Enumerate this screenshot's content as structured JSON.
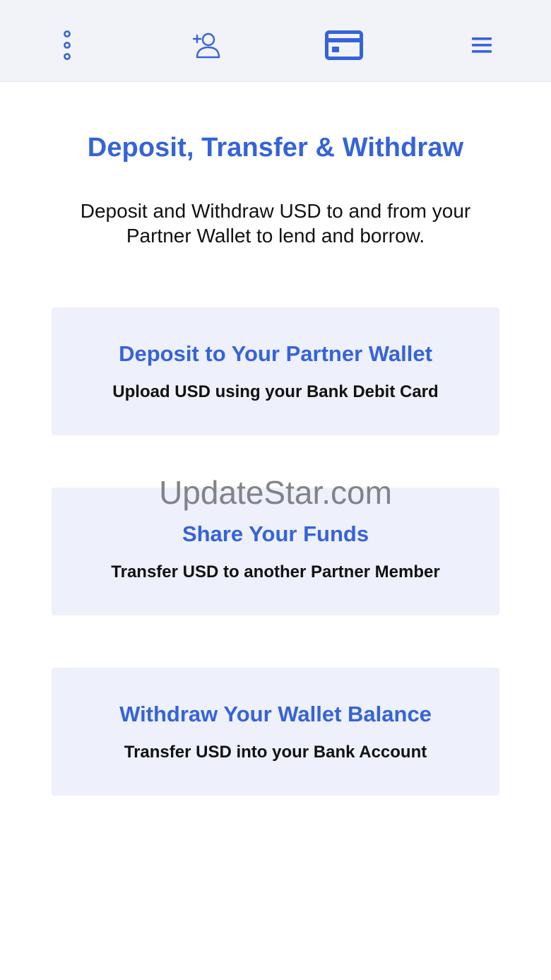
{
  "colors": {
    "accent": "#3563d9",
    "topbar_bg": "#f2f3f9",
    "card_bg": "#eef0fb",
    "text": "#111111"
  },
  "nav": {
    "items": [
      {
        "icon": "more-vertical-icon"
      },
      {
        "icon": "add-user-icon"
      },
      {
        "icon": "credit-card-icon"
      },
      {
        "icon": "hamburger-menu-icon"
      }
    ]
  },
  "header": {
    "title": "Deposit, Transfer & Withdraw",
    "subtitle_line1": "Deposit and Withdraw USD to and from your",
    "subtitle_line2": "Partner Wallet to lend and borrow."
  },
  "options": [
    {
      "title": "Deposit to Your Partner Wallet",
      "description": "Upload USD using your Bank Debit Card"
    },
    {
      "title": "Share Your Funds",
      "description": "Transfer USD to another Partner Member"
    },
    {
      "title": "Withdraw Your Wallet Balance",
      "description": "Transfer USD into your Bank Account"
    }
  ],
  "watermark": "UpdateStar.com"
}
